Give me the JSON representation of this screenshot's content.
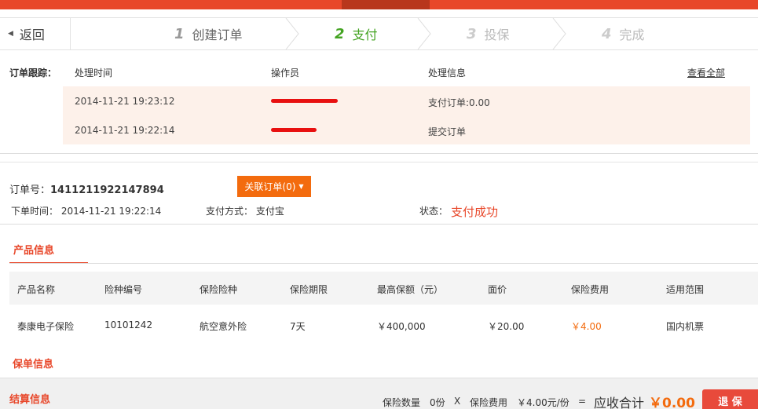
{
  "steps": {
    "back_label": "返回",
    "items": [
      {
        "num": "1",
        "label": "创建订单"
      },
      {
        "num": "2",
        "label": "支付"
      },
      {
        "num": "3",
        "label": "投保"
      },
      {
        "num": "4",
        "label": "完成"
      }
    ]
  },
  "tracking": {
    "label": "订单跟踪：",
    "headers": {
      "time": "处理时间",
      "operator": "操作员",
      "info": "处理信息"
    },
    "view_all": "查看全部",
    "rows": [
      {
        "time": "2014-11-21 19:23:12",
        "info": "支付订单:0.00"
      },
      {
        "time": "2014-11-21 19:22:14",
        "info": "提交订单"
      }
    ]
  },
  "order": {
    "number_label": "订单号：",
    "number": "1411211922147894",
    "related_button": "关联订单(0)",
    "created_label": "下单时间：",
    "created_value": "2014-11-21 19:22:14",
    "pay_label": "支付方式：",
    "pay_value": "支付宝",
    "status_label": "状态：",
    "status_value": "支付成功"
  },
  "product_section": {
    "tab_label": "产品信息",
    "headers": [
      "产品名称",
      "险种编号",
      "保险险种",
      "保险期限",
      "最高保额（元）",
      "面价",
      "保险费用",
      "适用范围"
    ],
    "row": [
      "泰康电子保险",
      "10101242",
      "航空意外险",
      "7天",
      "￥400,000",
      "￥20.00",
      "￥4.00",
      "国内机票"
    ]
  },
  "policy_section": {
    "label": "保单信息"
  },
  "settlement": {
    "label": "结算信息",
    "qty_label": "保险数量",
    "qty_value": "0份",
    "times": "X",
    "fee_label": "保险费用",
    "fee_value": "￥4.00元/份",
    "equals": "=",
    "total_label": "应收合计",
    "total_value": "￥0.00",
    "refund_button": "退 保"
  },
  "colors": {
    "brand_red": "#e8472a",
    "orange": "#f36b0e",
    "active_green": "#43a321",
    "track_bg": "#fdf1ea"
  }
}
